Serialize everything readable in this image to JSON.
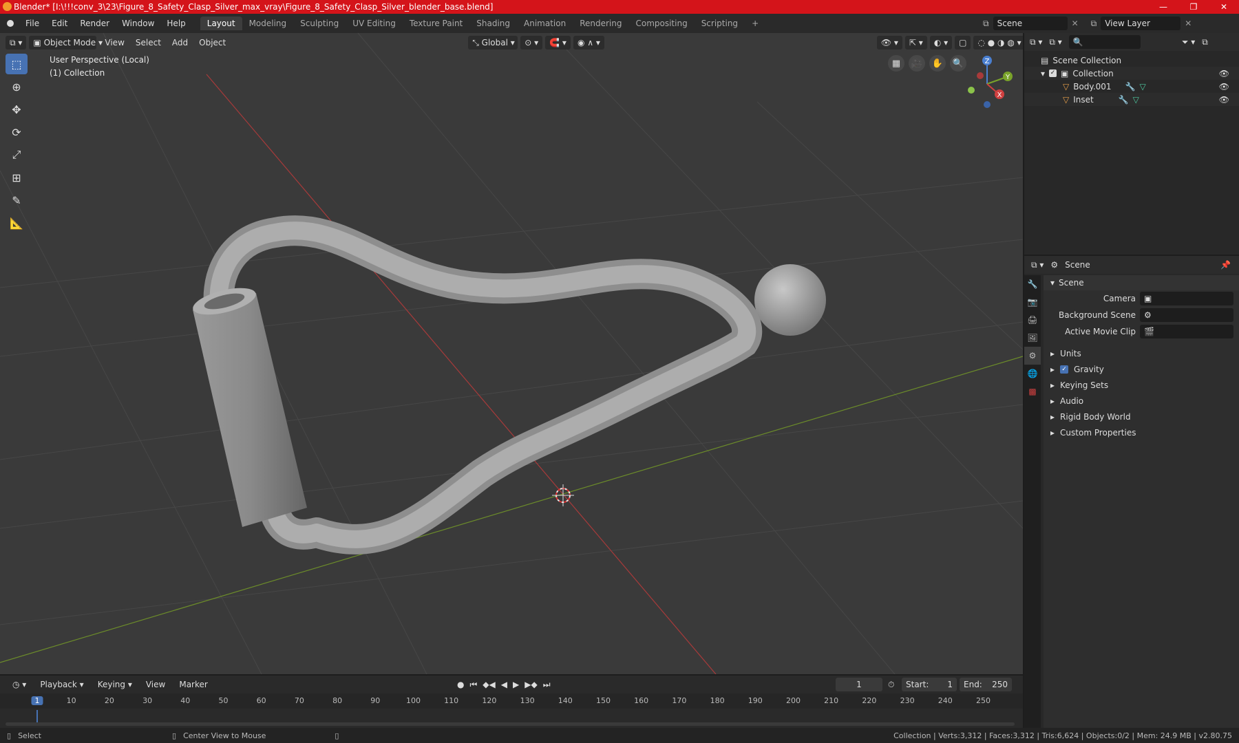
{
  "window": {
    "title": "Blender* [I:\\!!!conv_3\\23\\Figure_8_Safety_Clasp_Silver_max_vray\\Figure_8_Safety_Clasp_Silver_blender_base.blend]",
    "minimize": "—",
    "maximize": "❐",
    "close": "✕"
  },
  "menu": {
    "file": "File",
    "edit": "Edit",
    "render": "Render",
    "window": "Window",
    "help": "Help"
  },
  "workspaces": [
    "Layout",
    "Modeling",
    "Sculpting",
    "UV Editing",
    "Texture Paint",
    "Shading",
    "Animation",
    "Rendering",
    "Compositing",
    "Scripting"
  ],
  "topright": {
    "scene": "Scene",
    "view_layer": "View Layer"
  },
  "viewport": {
    "mode": "Object Mode",
    "view": "View",
    "select": "Select",
    "add": "Add",
    "object": "Object",
    "orientation": "Global",
    "info_line1": "User Perspective (Local)",
    "info_line2": "(1) Collection",
    "gizmo": {
      "x": "X",
      "y": "Y",
      "z": "Z"
    }
  },
  "outliner": {
    "scene_collection": "Scene Collection",
    "collection": "Collection",
    "items": [
      "Body.001",
      "Inset"
    ]
  },
  "properties": {
    "tab": "Scene",
    "panel": "Scene",
    "camera_label": "Camera",
    "bg_scene_label": "Background Scene",
    "movie_clip_label": "Active Movie Clip",
    "sections": [
      "Units",
      "Gravity",
      "Keying Sets",
      "Audio",
      "Rigid Body World",
      "Custom Properties"
    ]
  },
  "timeline": {
    "playback": "Playback",
    "keying": "Keying",
    "view": "View",
    "marker": "Marker",
    "current_frame": "1",
    "start_label": "Start:",
    "start": "1",
    "end_label": "End:",
    "end": "250",
    "ticks": [
      "1",
      "10",
      "20",
      "30",
      "40",
      "50",
      "60",
      "70",
      "80",
      "90",
      "100",
      "110",
      "120",
      "130",
      "140",
      "150",
      "160",
      "170",
      "180",
      "190",
      "200",
      "210",
      "220",
      "230",
      "240",
      "250"
    ]
  },
  "status": {
    "select": "Select",
    "center": "Center View to Mouse",
    "stats": "Collection | Verts:3,312 | Faces:3,312 | Tris:6,624 | Objects:0/2 | Mem: 24.9 MB | v2.80.75"
  },
  "colors": {
    "accent": "#4772b3",
    "title_red": "#d4141a",
    "x_axis": "#c0392b",
    "y_axis": "#7aa32a"
  }
}
